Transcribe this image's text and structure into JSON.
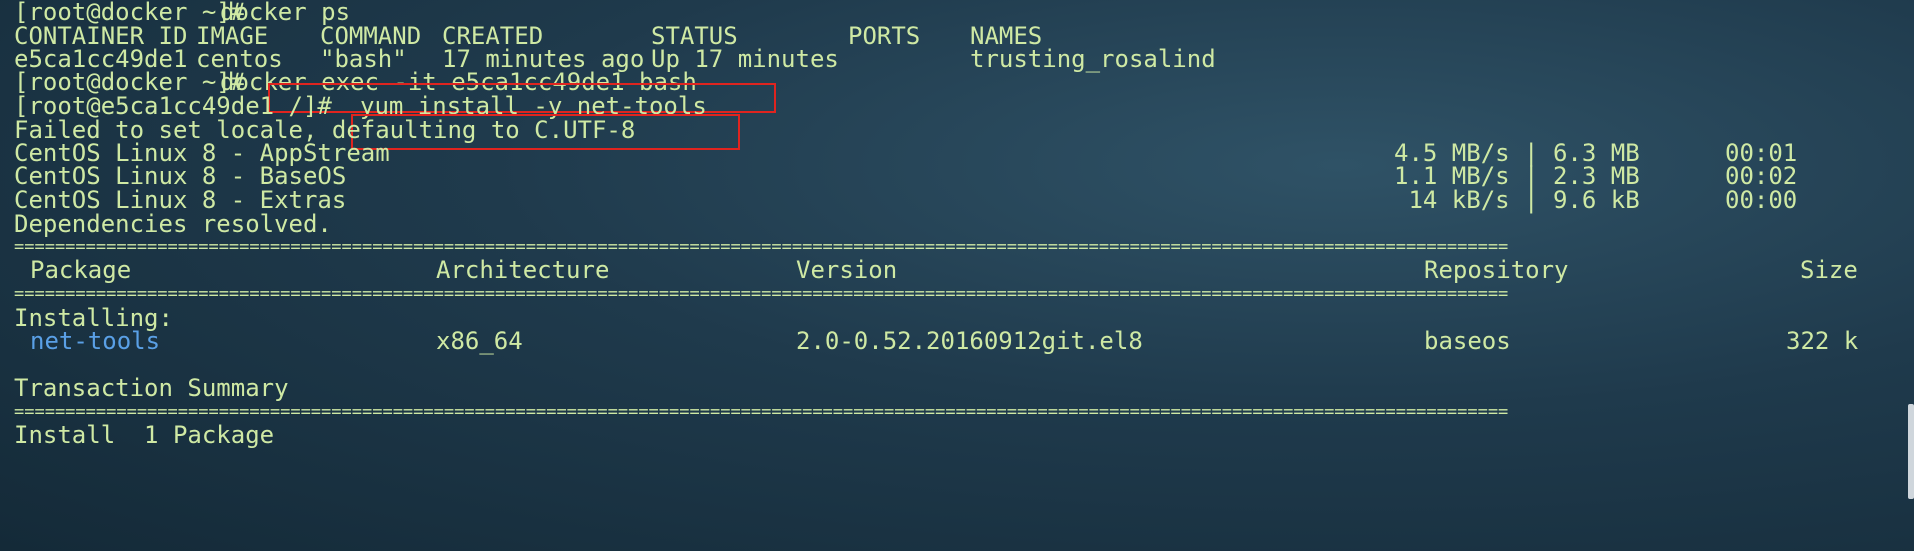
{
  "terminal": {
    "prompt1": "[root@docker ~]# ",
    "cmd1": "docker ps",
    "ps_header": {
      "container_id": "CONTAINER ID",
      "image": "IMAGE",
      "command": "COMMAND",
      "created": "CREATED",
      "status": "STATUS",
      "ports": "PORTS",
      "names": "NAMES"
    },
    "ps_row": {
      "container_id": "e5ca1cc49de1",
      "image": "centos",
      "command": "\"bash\"",
      "created": "17 minutes ago",
      "status": "Up 17 minutes",
      "ports": "",
      "names": "trusting_rosalind"
    },
    "prompt2": "[root@docker ~]# ",
    "cmd2": "docker exec -it e5ca1cc49de1 bash",
    "prompt3": "[root@e5ca1cc49de1 /]# ",
    "cmd3": "yum install -y net-tools",
    "locale_msg": "Failed to set locale, defaulting to C.UTF-8",
    "repos": [
      {
        "name": "CentOS Linux 8 - AppStream",
        "speed": "4.5 MB/s | 6.3 MB",
        "time": "00:01"
      },
      {
        "name": "CentOS Linux 8 - BaseOS",
        "speed": "1.1 MB/s | 2.3 MB",
        "time": "00:02"
      },
      {
        "name": "CentOS Linux 8 - Extras",
        "speed": " 14 kB/s | 9.6 kB",
        "time": "00:00"
      }
    ],
    "deps_msg": "Dependencies resolved.",
    "separator": "==================================================================================================================================================",
    "table_header": {
      "package": "Package",
      "architecture": "Architecture",
      "version": "Version",
      "repository": "Repository",
      "size": "Size"
    },
    "installing_label": "Installing:",
    "package_row": {
      "package": "net-tools",
      "architecture": "x86_64",
      "version": "2.0-0.52.20160912git.el8",
      "repository": "baseos",
      "size": "322 k"
    },
    "summary_label": "Transaction Summary",
    "install_line": "Install  1 Package"
  }
}
